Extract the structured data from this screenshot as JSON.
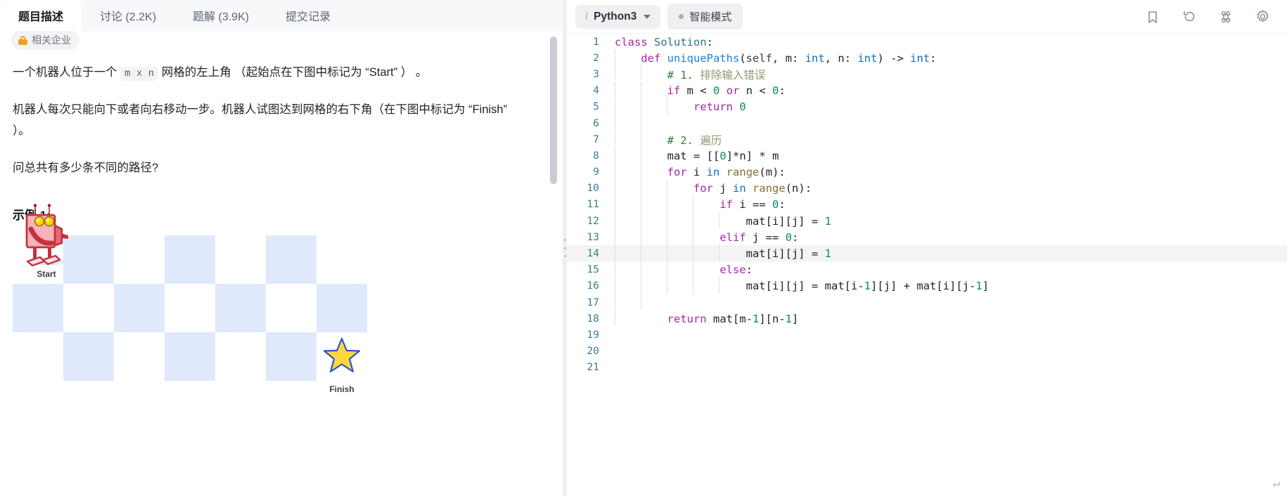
{
  "tabs": [
    {
      "label": "题目描述",
      "active": true
    },
    {
      "label": "讨论 (2.2K)",
      "active": false
    },
    {
      "label": "题解 (3.9K)",
      "active": false
    },
    {
      "label": "提交记录",
      "active": false
    }
  ],
  "company_chip": {
    "label": "相关企业",
    "icon": "lock-icon"
  },
  "problem": {
    "para1_before": "一个机器人位于一个 ",
    "para1_code": "m x n",
    "para1_after": " 网格的左上角 （起始点在下图中标记为 “Start” ） 。",
    "para2": "机器人每次只能向下或者向右移动一步。机器人试图达到网格的右下角（在下图中标记为 “Finish” ）。",
    "para3": "问总共有多少条不同的路径?",
    "example_title": "示例 1:"
  },
  "grid": {
    "rows": 3,
    "cols": 7,
    "start_label": "Start",
    "finish_label": "Finish",
    "blue": "#dfe9fb",
    "white": "#ffffff",
    "robot_color": "#e8505b",
    "star_color": "#ffd83d"
  },
  "editor_toolbar": {
    "language": "Python3",
    "language_info_icon": "info-icon",
    "language_chevron": "chevron-down-icon",
    "smart_mode": "智能模式",
    "icons": [
      {
        "name": "bookmark-icon"
      },
      {
        "name": "reset-icon"
      },
      {
        "name": "command-icon"
      },
      {
        "name": "settings-gear-icon"
      }
    ]
  },
  "code": {
    "active_line": 14,
    "total_lines": 21,
    "lines": [
      {
        "n": 1,
        "text": "class Solution:"
      },
      {
        "n": 2,
        "text": "    def uniquePaths(self, m: int, n: int) -> int:"
      },
      {
        "n": 3,
        "text": "        # 1. 排除输入错误"
      },
      {
        "n": 4,
        "text": "        if m < 0 or n < 0:"
      },
      {
        "n": 5,
        "text": "            return 0"
      },
      {
        "n": 6,
        "text": ""
      },
      {
        "n": 7,
        "text": "        # 2. 遍历"
      },
      {
        "n": 8,
        "text": "        mat = [[0]*n] * m"
      },
      {
        "n": 9,
        "text": "        for i in range(m):"
      },
      {
        "n": 10,
        "text": "            for j in range(n):"
      },
      {
        "n": 11,
        "text": "                if i == 0:"
      },
      {
        "n": 12,
        "text": "                    mat[i][j] = 1"
      },
      {
        "n": 13,
        "text": "                elif j == 0:"
      },
      {
        "n": 14,
        "text": "                    mat[i][j] = 1"
      },
      {
        "n": 15,
        "text": "                else:"
      },
      {
        "n": 16,
        "text": "                    mat[i][j] = mat[i-1][j] + mat[i][j-1]"
      },
      {
        "n": 17,
        "text": ""
      },
      {
        "n": 18,
        "text": "        return mat[m-1][n-1]"
      },
      {
        "n": 19,
        "text": ""
      },
      {
        "n": 20,
        "text": ""
      },
      {
        "n": 21,
        "text": ""
      }
    ]
  },
  "gutter_numbers": [
    "1",
    "2",
    "3",
    "4",
    "5",
    "6",
    "7",
    "8",
    "9",
    "10",
    "11",
    "12",
    "13",
    "14",
    "15",
    "16",
    "17",
    "18",
    "19",
    "20",
    "21"
  ]
}
